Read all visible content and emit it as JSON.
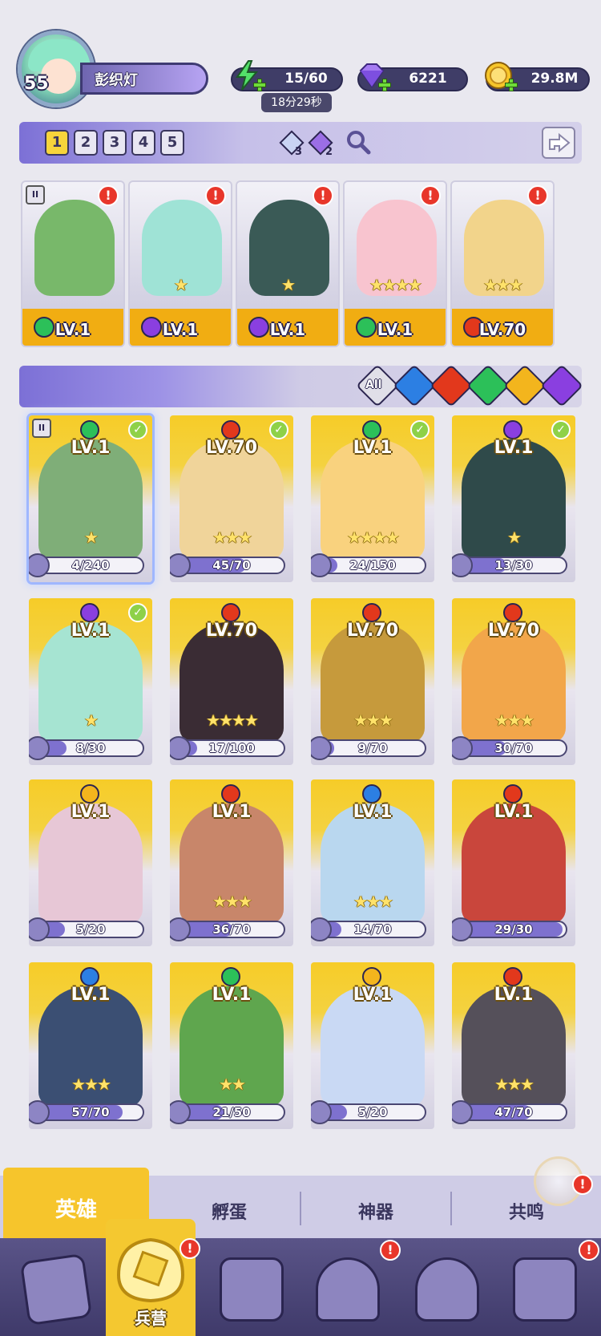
{
  "player": {
    "level": "55",
    "name": "彭织灯"
  },
  "resources": {
    "energy": "15/60",
    "energy_timer": "18分29秒",
    "gems": "6221",
    "gold": "29.8M"
  },
  "teams": {
    "tabs": [
      "1",
      "2",
      "3",
      "4",
      "5"
    ],
    "active": "1",
    "crystal_a_count": "3",
    "crystal_b_count": "2"
  },
  "team_slots": [
    {
      "element": "green",
      "level": "LV.1",
      "stars": 0,
      "alert": "!",
      "rank_icon": "II",
      "color": "#78b86a"
    },
    {
      "element": "purple",
      "level": "LV.1",
      "stars": 1,
      "alert": "!",
      "color": "#9fe3d6"
    },
    {
      "element": "purple",
      "level": "LV.1",
      "stars": 1,
      "alert": "!",
      "color": "#3a5a56"
    },
    {
      "element": "green",
      "level": "LV.1",
      "stars": 4,
      "alert": "!",
      "color": "#f8c4cf"
    },
    {
      "element": "fire",
      "level": "LV.70",
      "stars": 3,
      "alert": "!",
      "color": "#f2d48b"
    }
  ],
  "filters": {
    "all_label": "All",
    "elements": [
      "blue",
      "fire",
      "green",
      "light",
      "purple"
    ]
  },
  "heroes": [
    {
      "element": "green",
      "level": "LV.1",
      "progress": "4/240",
      "frac": 0.02,
      "stars": 1,
      "check": true,
      "rank_icon": "II",
      "selected": true,
      "color": "#7fae78"
    },
    {
      "element": "fire",
      "level": "LV.70",
      "progress": "45/70",
      "frac": 0.64,
      "stars": 3,
      "check": true,
      "color": "#f0d49a"
    },
    {
      "element": "green",
      "level": "LV.1",
      "progress": "24/150",
      "frac": 0.16,
      "stars": 4,
      "check": true,
      "color": "#f9d27e"
    },
    {
      "element": "purple",
      "level": "LV.1",
      "progress": "13/30",
      "frac": 0.43,
      "stars": 1,
      "check": true,
      "color": "#2f4a4a"
    },
    {
      "element": "purple",
      "level": "LV.1",
      "progress": "8/30",
      "frac": 0.27,
      "stars": 1,
      "check": true,
      "color": "#a6e4d2"
    },
    {
      "element": "fire",
      "level": "LV.70",
      "progress": "17/100",
      "frac": 0.17,
      "stars": 4,
      "check": false,
      "color": "#3a2c34"
    },
    {
      "element": "fire",
      "level": "LV.70",
      "progress": "9/70",
      "frac": 0.13,
      "stars": 3,
      "check": false,
      "color": "#c69a3c"
    },
    {
      "element": "fire",
      "level": "LV.70",
      "progress": "30/70",
      "frac": 0.43,
      "stars": 3,
      "check": false,
      "color": "#f2a64a"
    },
    {
      "element": "light",
      "level": "LV.1",
      "progress": "5/20",
      "frac": 0.25,
      "stars": 0,
      "check": false,
      "color": "#e7c7d6"
    },
    {
      "element": "fire",
      "level": "LV.1",
      "progress": "36/70",
      "frac": 0.51,
      "stars": 3,
      "check": false,
      "color": "#c8866a"
    },
    {
      "element": "blue",
      "level": "LV.1",
      "progress": "14/70",
      "frac": 0.2,
      "stars": 3,
      "check": false,
      "color": "#b9d7ef"
    },
    {
      "element": "fire",
      "level": "LV.1",
      "progress": "29/30",
      "frac": 0.97,
      "stars": 0,
      "check": false,
      "color": "#c9463c"
    },
    {
      "element": "blue",
      "level": "LV.1",
      "progress": "57/70",
      "frac": 0.81,
      "stars": 3,
      "check": false,
      "color": "#3b4f73"
    },
    {
      "element": "green",
      "level": "LV.1",
      "progress": "21/50",
      "frac": 0.42,
      "stars": 2,
      "check": false,
      "color": "#5fa64e"
    },
    {
      "element": "light",
      "level": "LV.1",
      "progress": "5/20",
      "frac": 0.25,
      "stars": 0,
      "check": false,
      "color": "#c9d9f4"
    },
    {
      "element": "fire",
      "level": "LV.1",
      "progress": "47/70",
      "frac": 0.67,
      "stars": 3,
      "check": false,
      "color": "#55505a"
    }
  ],
  "subtabs": [
    "英雄",
    "孵蛋",
    "神器",
    "共鸣"
  ],
  "subtab_active": "英雄",
  "nav": {
    "active_label": "兵营",
    "items": [
      "cards-icon",
      "barracks-icon",
      "map-icon",
      "castle-icon",
      "mushroom-icon",
      "banner-icon"
    ],
    "alert": "!"
  },
  "colors": {
    "green": "#2cc059",
    "purple": "#8a3fe0",
    "fire": "#e2381c",
    "blue": "#2c7fe3",
    "light": "#f3b51d",
    "accent_yellow": "#f6c52c",
    "nav_bg": "#4a4478"
  }
}
